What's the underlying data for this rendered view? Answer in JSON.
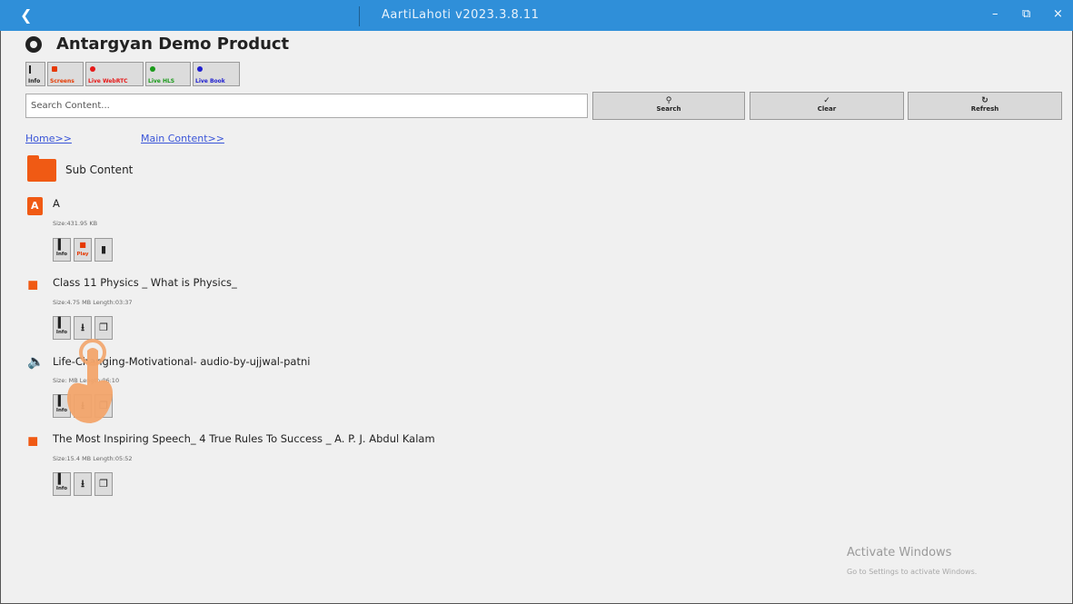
{
  "titlebar": {
    "title": "AartiLahoti v2023.3.8.11",
    "back_icon": "chevron-left-icon",
    "minimize": "–",
    "maximize": "⧉",
    "close": "×",
    "color": "#2f8fd9"
  },
  "header": {
    "app_icon": "gear-icon",
    "title": "Antargyan Demo Product"
  },
  "top_buttons": [
    {
      "label": "Info",
      "icon": "info-icon"
    },
    {
      "label": "Screens",
      "icon": "video-icon",
      "color": "#e63900"
    },
    {
      "label": "Live WebRTC",
      "icon": "record-icon",
      "color": "#e61919"
    },
    {
      "label": "Live HLS",
      "icon": "record-icon",
      "color": "#1a9a1a"
    },
    {
      "label": "Live Book",
      "icon": "record-icon",
      "color": "#2020d0"
    }
  ],
  "search": {
    "placeholder": "Search Content...",
    "search_label": "Search",
    "clear_label": "Clear",
    "refresh_label": "Refresh"
  },
  "breadcrumb": {
    "home": "Home>>",
    "main": "Main Content>>"
  },
  "folder": {
    "label": "Sub Content",
    "icon": "folder-icon"
  },
  "items": [
    {
      "title": "A",
      "meta": "Size:431.95 KB",
      "icon": "pdf-icon",
      "actions": [
        {
          "label": "Info",
          "icon": "info-icon"
        },
        {
          "label": "Play",
          "icon": "video-icon"
        },
        {
          "label": "",
          "icon": "trash-icon"
        }
      ]
    },
    {
      "title": "Class 11 Physics _ What is Physics_",
      "meta": "Size:4.75 MB Length:03:37",
      "icon": "video-icon",
      "actions": [
        {
          "label": "Info",
          "icon": "info-icon"
        },
        {
          "label": "",
          "icon": "download-icon"
        },
        {
          "label": "",
          "icon": "copy-icon"
        }
      ]
    },
    {
      "title": "Life-Changing-Motivational- audio-by-ujjwal-patni",
      "meta": "Size: MB Length:06:10",
      "icon": "audio-icon",
      "actions": [
        {
          "label": "Info",
          "icon": "info-icon"
        },
        {
          "label": "",
          "icon": "download-icon"
        },
        {
          "label": "",
          "icon": "copy-icon"
        }
      ]
    },
    {
      "title": "The Most Inspiring Speech_ 4 True Rules To Success _ A. P. J. Abdul Kalam",
      "meta": "Size:15.4 MB Length:05:52",
      "icon": "video-icon",
      "actions": [
        {
          "label": "Info",
          "icon": "info-icon"
        },
        {
          "label": "",
          "icon": "download-icon"
        },
        {
          "label": "",
          "icon": "copy-icon"
        }
      ]
    }
  ],
  "watermark": {
    "line1": "Activate Windows",
    "line2": "Go to Settings to activate Windows."
  },
  "accent_color": "#f05a14"
}
